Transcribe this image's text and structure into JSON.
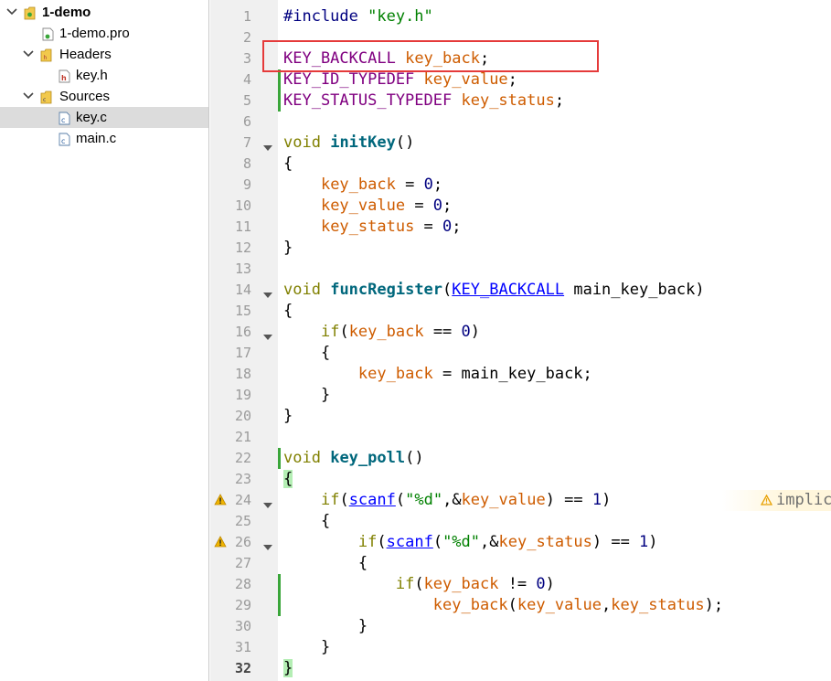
{
  "project_tree": {
    "project": {
      "label": "1-demo"
    },
    "pro_file": {
      "label": "1-demo.pro"
    },
    "headers": {
      "label": "Headers",
      "items": [
        "key.h"
      ]
    },
    "sources": {
      "label": "Sources",
      "items": [
        "key.c",
        "main.c"
      ]
    },
    "selected": "key.c"
  },
  "editor": {
    "current_line": 32,
    "line_numbers": [
      "1",
      "2",
      "3",
      "4",
      "5",
      "6",
      "7",
      "8",
      "9",
      "10",
      "11",
      "12",
      "13",
      "14",
      "15",
      "16",
      "17",
      "18",
      "19",
      "20",
      "21",
      "22",
      "23",
      "24",
      "25",
      "26",
      "27",
      "28",
      "29",
      "30",
      "31",
      "32"
    ],
    "lines": [
      [
        {
          "t": "#include ",
          "c": "pp"
        },
        {
          "t": "\"key.h\"",
          "c": "str"
        }
      ],
      [],
      [
        {
          "t": "KEY_BACKCALL",
          "c": "typ"
        },
        {
          "t": " "
        },
        {
          "t": "key_back",
          "c": "var"
        },
        {
          "t": ";"
        }
      ],
      [
        {
          "t": "KEY_ID_TYPEDEF",
          "c": "typ"
        },
        {
          "t": " "
        },
        {
          "t": "key_value",
          "c": "var"
        },
        {
          "t": ";"
        }
      ],
      [
        {
          "t": "KEY_STATUS_TYPEDEF",
          "c": "typ"
        },
        {
          "t": " "
        },
        {
          "t": "key_status",
          "c": "var"
        },
        {
          "t": ";"
        }
      ],
      [],
      [
        {
          "t": "void",
          "c": "kw"
        },
        {
          "t": " "
        },
        {
          "t": "initKey",
          "c": "fn"
        },
        {
          "t": "()"
        }
      ],
      [
        {
          "t": "{"
        }
      ],
      [
        {
          "t": "    "
        },
        {
          "t": "key_back",
          "c": "var"
        },
        {
          "t": " = "
        },
        {
          "t": "0",
          "c": "num"
        },
        {
          "t": ";"
        }
      ],
      [
        {
          "t": "    "
        },
        {
          "t": "key_value",
          "c": "var"
        },
        {
          "t": " = "
        },
        {
          "t": "0",
          "c": "num"
        },
        {
          "t": ";"
        }
      ],
      [
        {
          "t": "    "
        },
        {
          "t": "key_status",
          "c": "var"
        },
        {
          "t": " = "
        },
        {
          "t": "0",
          "c": "num"
        },
        {
          "t": ";"
        }
      ],
      [
        {
          "t": "}"
        }
      ],
      [],
      [
        {
          "t": "void",
          "c": "kw"
        },
        {
          "t": " "
        },
        {
          "t": "funcRegister",
          "c": "fn"
        },
        {
          "t": "("
        },
        {
          "t": "KEY_BACKCALL",
          "c": "lnk"
        },
        {
          "t": " main_key_back)"
        }
      ],
      [
        {
          "t": "{"
        }
      ],
      [
        {
          "t": "    "
        },
        {
          "t": "if",
          "c": "kw"
        },
        {
          "t": "("
        },
        {
          "t": "key_back",
          "c": "var"
        },
        {
          "t": " == "
        },
        {
          "t": "0",
          "c": "num"
        },
        {
          "t": ")"
        }
      ],
      [
        {
          "t": "    {"
        }
      ],
      [
        {
          "t": "        "
        },
        {
          "t": "key_back",
          "c": "var"
        },
        {
          "t": " = main_key_back;"
        }
      ],
      [
        {
          "t": "    }"
        }
      ],
      [
        {
          "t": "}"
        }
      ],
      [],
      [
        {
          "t": "void",
          "c": "kw"
        },
        {
          "t": " "
        },
        {
          "t": "key_poll",
          "c": "fn"
        },
        {
          "t": "()"
        }
      ],
      [
        {
          "t": "{",
          "c": "brace-match"
        }
      ],
      [
        {
          "t": "    "
        },
        {
          "t": "if",
          "c": "kw"
        },
        {
          "t": "("
        },
        {
          "t": "scanf",
          "c": "lnk"
        },
        {
          "t": "("
        },
        {
          "t": "\"%d\"",
          "c": "str"
        },
        {
          "t": ",&"
        },
        {
          "t": "key_value",
          "c": "var"
        },
        {
          "t": ") == "
        },
        {
          "t": "1",
          "c": "num"
        },
        {
          "t": ")"
        }
      ],
      [
        {
          "t": "    {"
        }
      ],
      [
        {
          "t": "        "
        },
        {
          "t": "if",
          "c": "kw"
        },
        {
          "t": "("
        },
        {
          "t": "scanf",
          "c": "lnk"
        },
        {
          "t": "("
        },
        {
          "t": "\"%d\"",
          "c": "str"
        },
        {
          "t": ",&"
        },
        {
          "t": "key_status",
          "c": "var"
        },
        {
          "t": ") == "
        },
        {
          "t": "1",
          "c": "num"
        },
        {
          "t": ")"
        }
      ],
      [
        {
          "t": "        {"
        }
      ],
      [
        {
          "t": "            "
        },
        {
          "t": "if",
          "c": "kw"
        },
        {
          "t": "("
        },
        {
          "t": "key_back",
          "c": "var"
        },
        {
          "t": " != "
        },
        {
          "t": "0",
          "c": "num"
        },
        {
          "t": ")"
        }
      ],
      [
        {
          "t": "                "
        },
        {
          "t": "key_back",
          "c": "var"
        },
        {
          "t": "("
        },
        {
          "t": "key_value",
          "c": "var"
        },
        {
          "t": ","
        },
        {
          "t": "key_status",
          "c": "var"
        },
        {
          "t": ");"
        }
      ],
      [
        {
          "t": "        }"
        }
      ],
      [
        {
          "t": "    }"
        }
      ],
      [
        {
          "t": "}",
          "c": "brace-match"
        }
      ]
    ],
    "inline_warning": {
      "text": "implic"
    }
  },
  "colors": {
    "highlight_box": "#e53a3a",
    "modified_bar": "#3aa63a",
    "warning": "#e8a000"
  }
}
